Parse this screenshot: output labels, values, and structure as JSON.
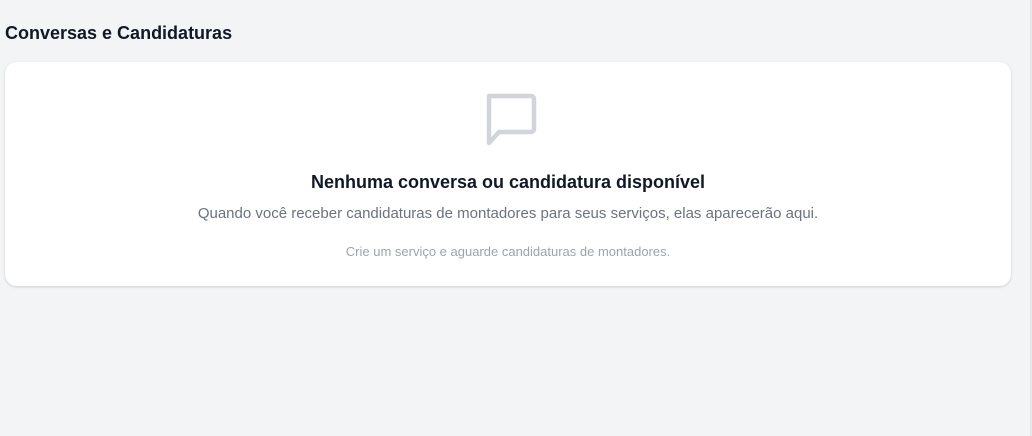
{
  "header": {
    "title": "Conversas e Candidaturas"
  },
  "empty_state": {
    "icon": "chat-bubble-icon",
    "title": "Nenhuma conversa ou candidatura disponível",
    "description": "Quando você receber candidaturas de montadores para seus serviços, elas aparecerão aqui.",
    "hint": "Crie um serviço e aguarde candidaturas de montadores."
  },
  "colors": {
    "background": "#f3f4f6",
    "card": "#ffffff",
    "title_text": "#111827",
    "body_text": "#6b7280",
    "hint_text": "#9ca3af",
    "icon": "#d1d5db"
  }
}
